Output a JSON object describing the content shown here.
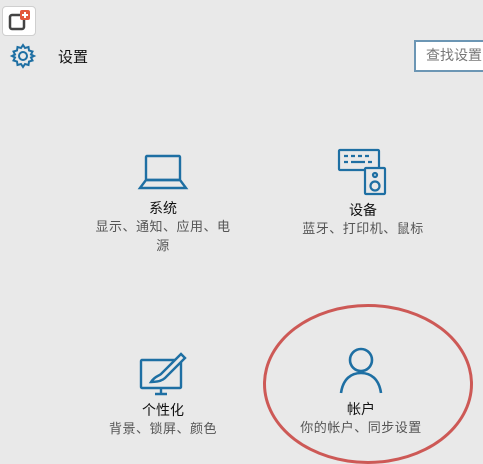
{
  "window": {
    "title": "设置"
  },
  "search": {
    "placeholder": "查找设置"
  },
  "tiles": [
    {
      "title": "系统",
      "desc_line1": "显示、通知、应用、电",
      "desc_line2": "源",
      "icon": "laptop-icon"
    },
    {
      "title": "设备",
      "desc_line1": "蓝牙、打印机、鼠标",
      "icon": "devices-icon"
    },
    {
      "title": "个性化",
      "desc_line1": "背景、锁屏、颜色",
      "icon": "personalization-icon"
    },
    {
      "title": "帐户",
      "desc_line1": "你的帐户、同步设置",
      "icon": "account-icon"
    }
  ],
  "colors": {
    "accent": "#1e6fa3",
    "background": "#e9e9e9",
    "annotation": "#c8403c"
  }
}
